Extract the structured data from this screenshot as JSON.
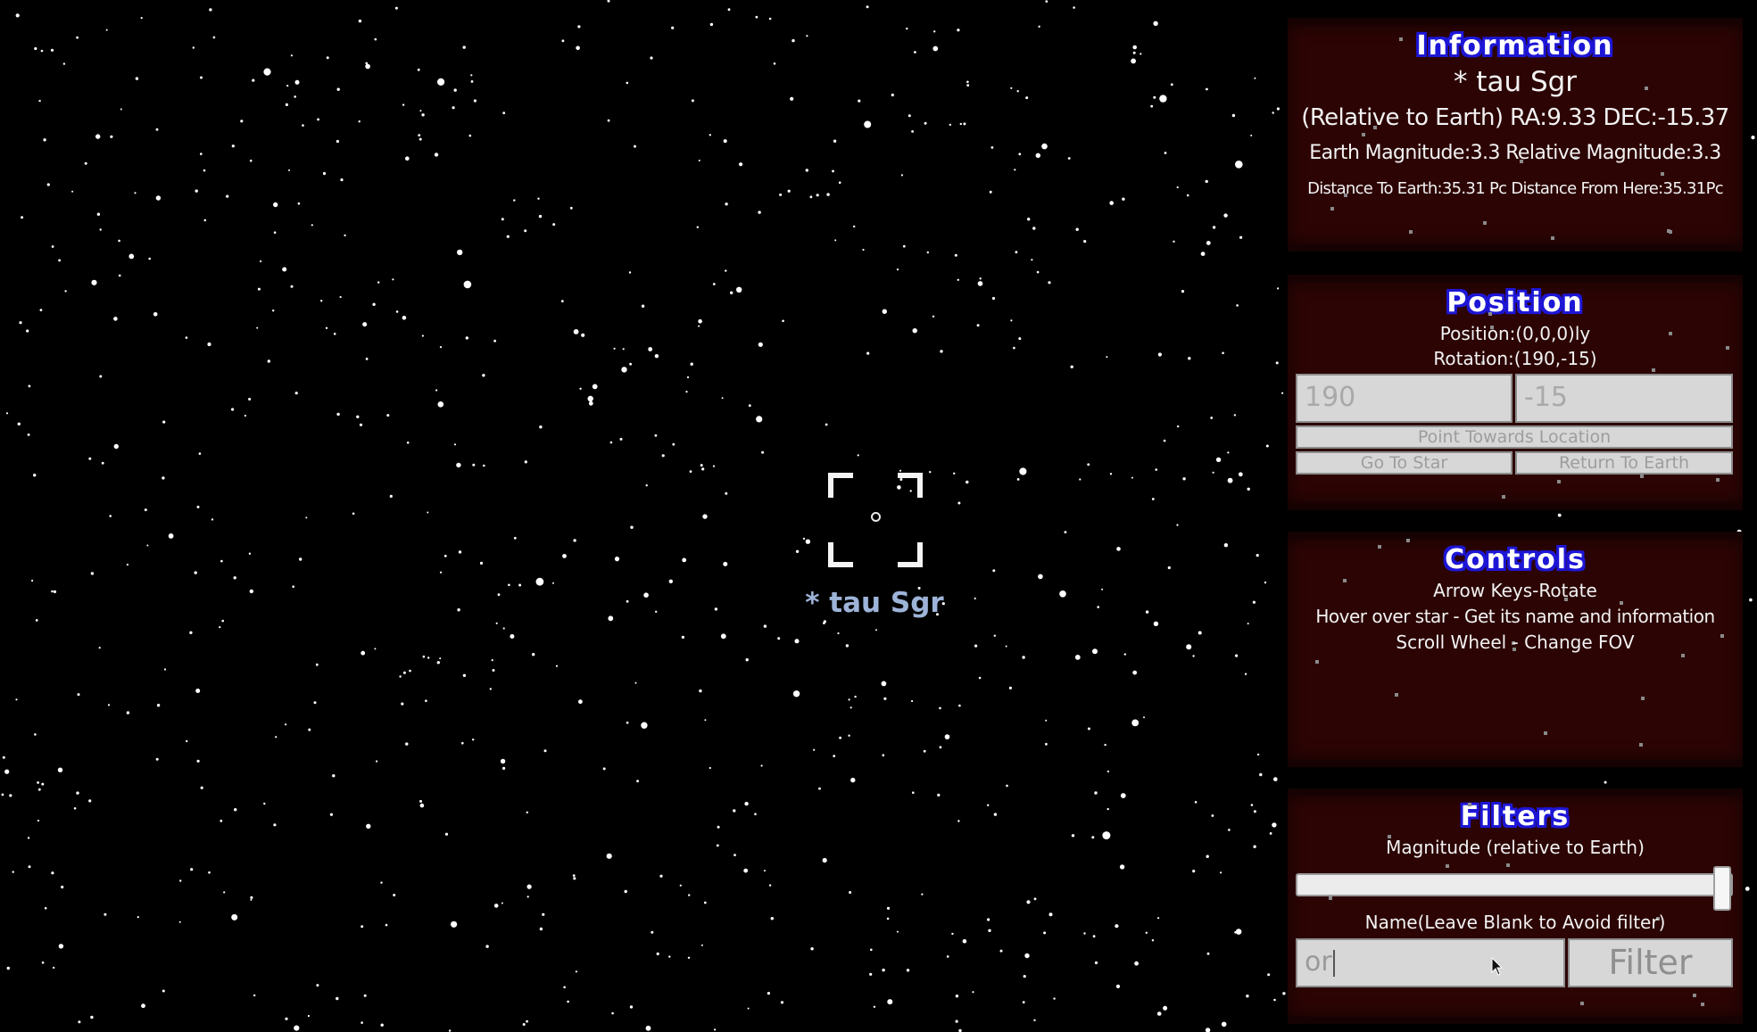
{
  "target": {
    "label": "* tau Sgr"
  },
  "information": {
    "title": "Information",
    "star_name": "* tau Sgr",
    "coords": "(Relative to Earth) RA:9.33 DEC:-15.37",
    "magnitude": "Earth Magnitude:3.3 Relative Magnitude:3.3",
    "distance": "Distance To Earth:35.31 Pc Distance From Here:35.31Pc"
  },
  "position": {
    "title": "Position",
    "position_text": "Position:(0,0,0)ly",
    "rotation_text": "Rotation:(190,-15)",
    "input_x": "190",
    "input_y": "-15",
    "point_button": "Point Towards Location",
    "goto_button": "Go To Star",
    "return_button": "Return To Earth"
  },
  "controls": {
    "title": "Controls",
    "lines": [
      "Arrow Keys-Rotate",
      "Hover over star - Get its name and information",
      "Scroll Wheel - Change FOV"
    ]
  },
  "filters": {
    "title": "Filters",
    "magnitude_label": "Magnitude (relative to Earth)",
    "magnitude_value": 1.0,
    "name_label": "Name(Leave Blank to Avoid filter)",
    "name_value": "or",
    "filter_button": "Filter"
  },
  "colors": {
    "panel_bg": "#2c0404",
    "title_outline": "#1d16d6",
    "label_color": "#9db3d8"
  }
}
